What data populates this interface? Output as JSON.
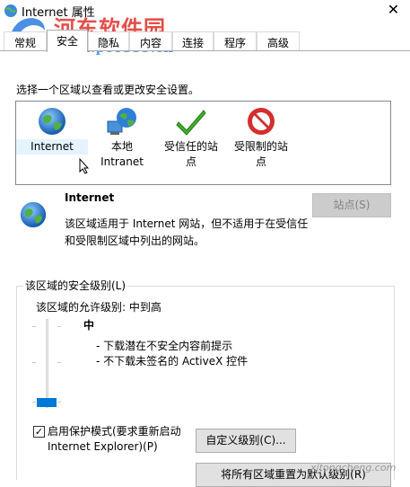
{
  "window": {
    "title": "Internet 属性",
    "close_glyph": "✕"
  },
  "watermark": {
    "site_name": "河东软件园",
    "site_url": "www.pc0359.cn",
    "bottom_text": "xitongcheng.com"
  },
  "tabs": [
    {
      "label": "常规"
    },
    {
      "label": "安全"
    },
    {
      "label": "隐私"
    },
    {
      "label": "内容"
    },
    {
      "label": "连接"
    },
    {
      "label": "程序"
    },
    {
      "label": "高级"
    }
  ],
  "active_tab": "安全",
  "security": {
    "instruction": "选择一个区域以查看或更改安全设置。",
    "zones": [
      {
        "label": "Internet",
        "icon": "globe-icon"
      },
      {
        "label": "本地\nIntranet",
        "icon": "intranet-icon"
      },
      {
        "label": "受信任的站\n点",
        "icon": "checkmark-icon"
      },
      {
        "label": "受限制的站\n点",
        "icon": "no-entry-icon"
      }
    ],
    "selected_zone": {
      "name": "Internet",
      "description": "该区域适用于 Internet 网站，但不适用于在受信任和受限制区域中列出的网站。"
    },
    "sites_button": "站点(S)",
    "level_group_title": "该区域的安全级别(L)",
    "allowed_levels": "该区域的允许级别: 中到高",
    "level": {
      "name": "中",
      "bullets": [
        "- 下载潜在不安全内容前提示",
        "- 不下载未签名的 ActiveX 控件"
      ]
    },
    "protected_mode": {
      "checked": true,
      "check_glyph": "✓",
      "label": "启用保护模式(要求重新启动 Internet Explorer)(P)"
    },
    "custom_level_button": "自定义级别(C)...",
    "default_all_button": "将所有区域重置为默认级别(R)"
  },
  "colors": {
    "accent": "#0078d7",
    "watermark_red": "#e33b35",
    "watermark_blue": "#2a7ce0"
  }
}
